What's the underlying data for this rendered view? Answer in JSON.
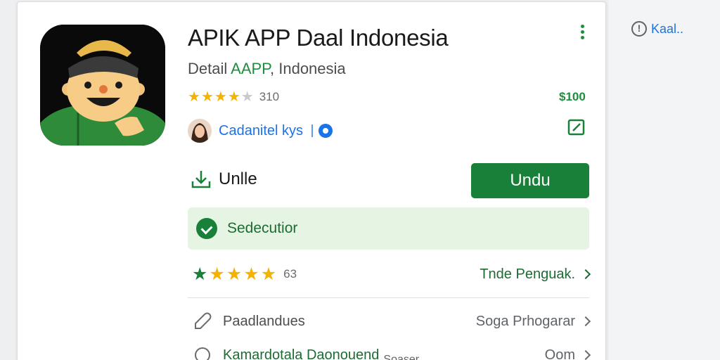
{
  "app": {
    "title": "APIK APP Daal Indonesia",
    "subtitle_prefix": "Detail ",
    "subtitle_accent": "AAPP",
    "subtitle_suffix": ", Indonesia",
    "rating_value": 3.5,
    "rating_count": "310",
    "price": "$100"
  },
  "developer": {
    "name": "Cadanitel kys"
  },
  "download": {
    "label": "Unlle",
    "button_label": "Undu"
  },
  "banner": {
    "text": "Sedecutior"
  },
  "reviews": {
    "count": "63",
    "link_label": "Tnde Penguak."
  },
  "list": [
    {
      "label": "Paadlandues",
      "value": "Soga Prhogarar"
    },
    {
      "label": "Kamardotala Daonouend",
      "middle": "Soaser",
      "value": "Oom"
    }
  ],
  "side": {
    "link_label": "Kaal.."
  },
  "colors": {
    "accent_green": "#188038",
    "link_blue": "#1a73e8",
    "banner_bg": "#e6f4e3",
    "star_yellow": "#f5b301"
  }
}
